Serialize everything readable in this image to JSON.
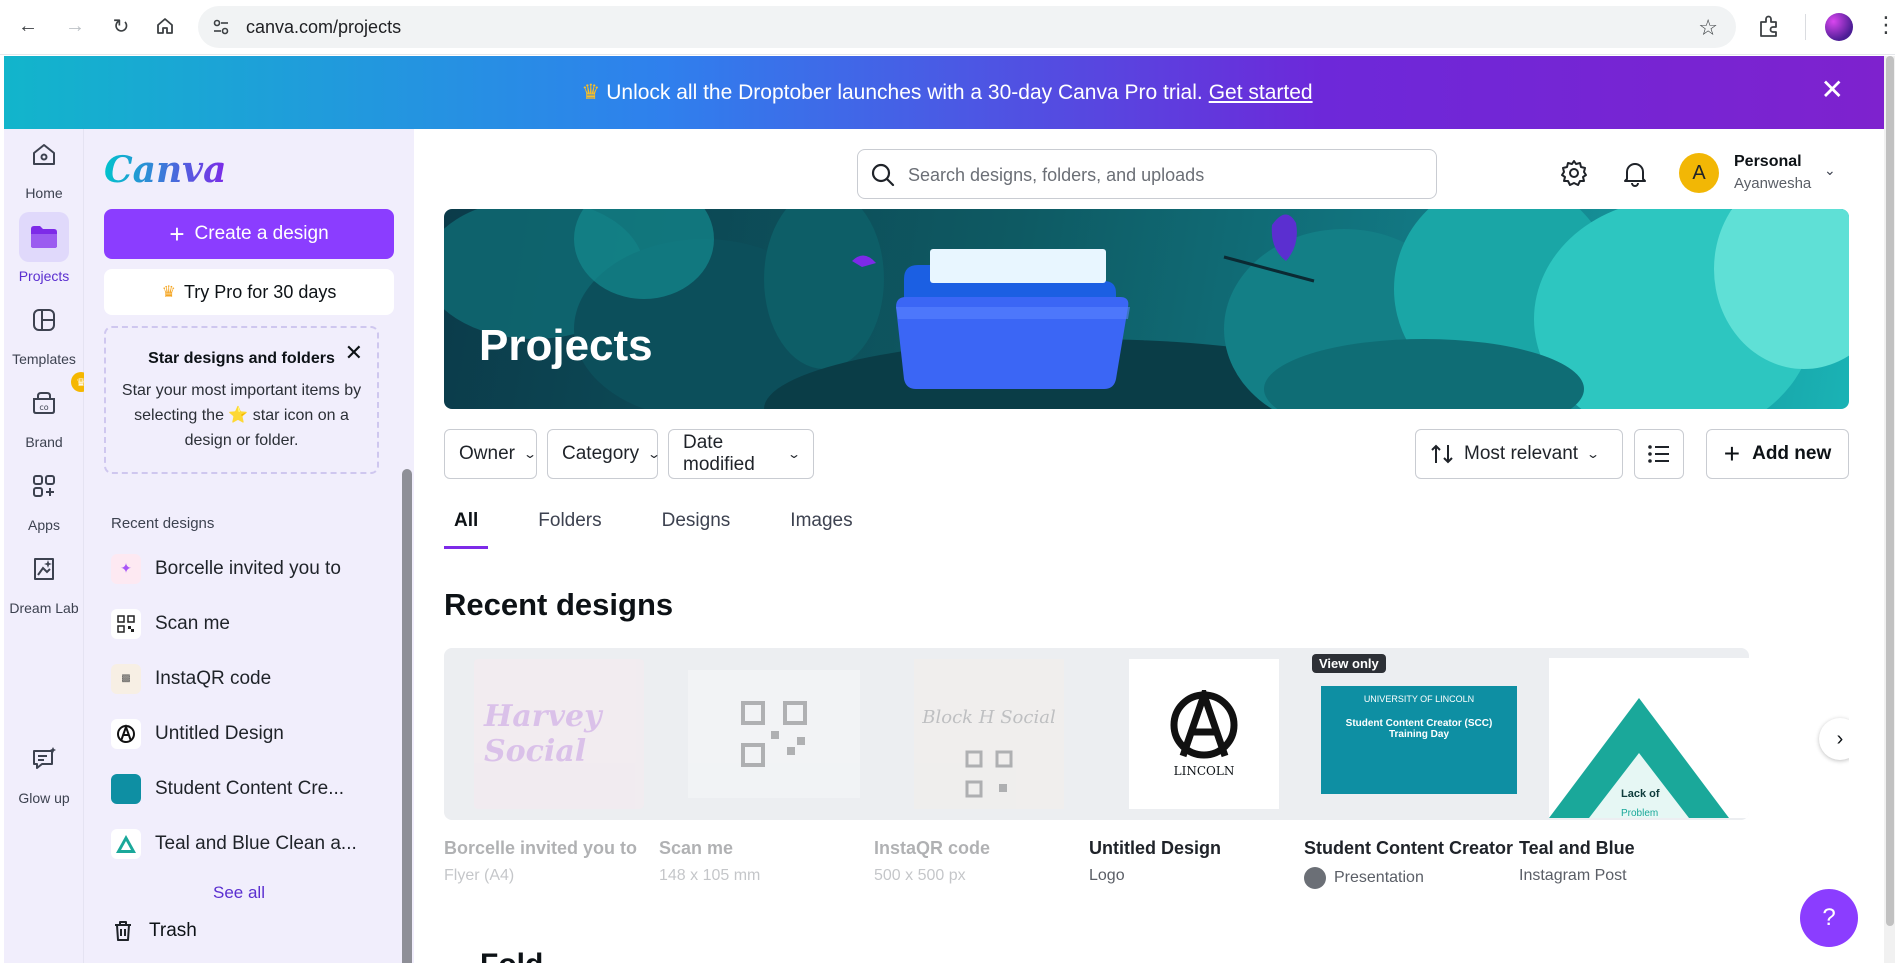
{
  "browser": {
    "url": "canva.com/projects"
  },
  "promo": {
    "text": "Unlock all the Droptober launches with a 30-day Canva Pro trial.",
    "link": "Get started"
  },
  "rail": {
    "items": [
      {
        "label": "Home",
        "icon": "home-icon"
      },
      {
        "label": "Projects",
        "icon": "folder-icon"
      },
      {
        "label": "Templates",
        "icon": "templates-icon"
      },
      {
        "label": "Brand",
        "icon": "brand-icon"
      },
      {
        "label": "Apps",
        "icon": "apps-icon"
      },
      {
        "label": "Dream Lab",
        "icon": "dream-lab-icon"
      },
      {
        "label": "Glow up",
        "icon": "glow-up-icon"
      }
    ]
  },
  "sidebar": {
    "logo": "Canva",
    "create_label": "Create a design",
    "pro_label": "Try Pro for 30 days",
    "tip": {
      "title": "Star designs and folders",
      "body_before": "Star your most important items by selecting the",
      "body_after": "star icon on a design or folder."
    },
    "recent_title": "Recent designs",
    "recent": [
      {
        "label": "Borcelle invited you to"
      },
      {
        "label": "Scan me"
      },
      {
        "label": "InstaQR code"
      },
      {
        "label": "Untitled Design"
      },
      {
        "label": "Student Content Cre..."
      },
      {
        "label": "Teal and Blue Clean a..."
      }
    ],
    "see_all": "See all",
    "trash": "Trash"
  },
  "header": {
    "search_placeholder": "Search designs, folders, and uploads",
    "account_type": "Personal",
    "account_name": "Ayanwesha",
    "avatar_initial": "A"
  },
  "hero": {
    "title": "Projects"
  },
  "filters": {
    "owner": "Owner",
    "category": "Category",
    "date": "Date modified",
    "sort": "Most relevant",
    "add_new": "Add new"
  },
  "tabs": [
    "All",
    "Folders",
    "Designs",
    "Images"
  ],
  "recent_section": {
    "title": "Recent designs",
    "cards": [
      {
        "name": "Borcelle invited you to",
        "sub": "Flyer (A4)",
        "thumb_text": "Harvey Social"
      },
      {
        "name": "Scan me",
        "sub": "148 x 105 mm"
      },
      {
        "name": "InstaQR code",
        "sub": "500 x 500 px",
        "thumb_text": "Block H Social"
      },
      {
        "name": "Untitled Design",
        "sub": "Logo",
        "thumb_text": "LINCOLN"
      },
      {
        "name": "Student Content Creator",
        "sub": "Presentation",
        "badge": "View only",
        "thumb_header": "UNIVERSITY OF LINCOLN",
        "thumb_text": "Student Content Creator (SCC) Training Day"
      },
      {
        "name": "Teal and Blue",
        "sub": "Instagram Post",
        "thumb_text": "Lack of",
        "thumb_text_2": "Problem"
      }
    ]
  },
  "help_label": "?",
  "folders_peek": "Fold"
}
